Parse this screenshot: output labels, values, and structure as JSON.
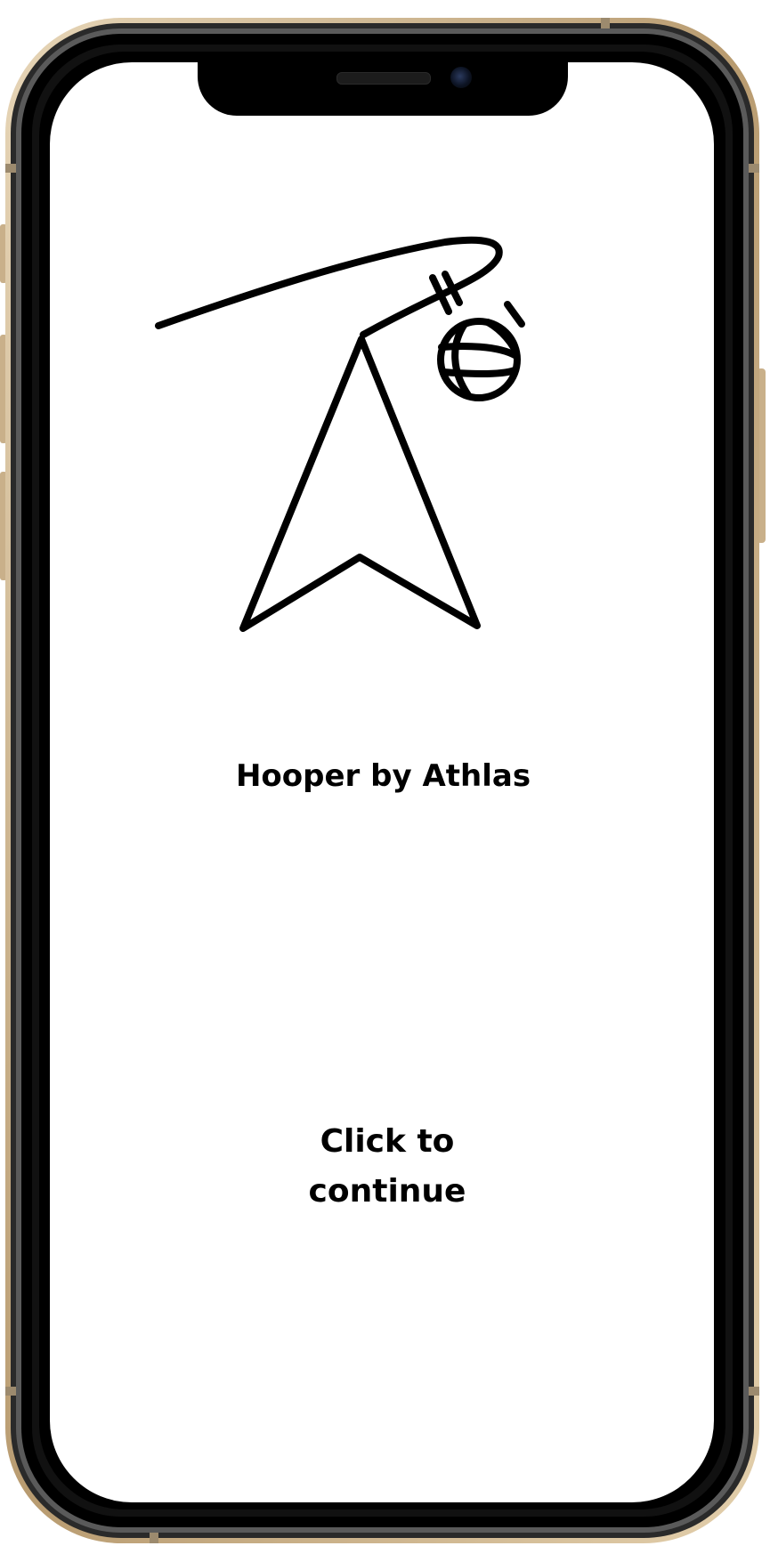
{
  "app": {
    "title": "Hooper by Athlas",
    "continue_label": "Click to continue"
  },
  "icons": {
    "logo": "basketball-arrow-logo-icon"
  },
  "colors": {
    "background": "#ffffff",
    "text": "#000000",
    "frame_gold": "#c9b08a",
    "frame_black": "#000000"
  }
}
